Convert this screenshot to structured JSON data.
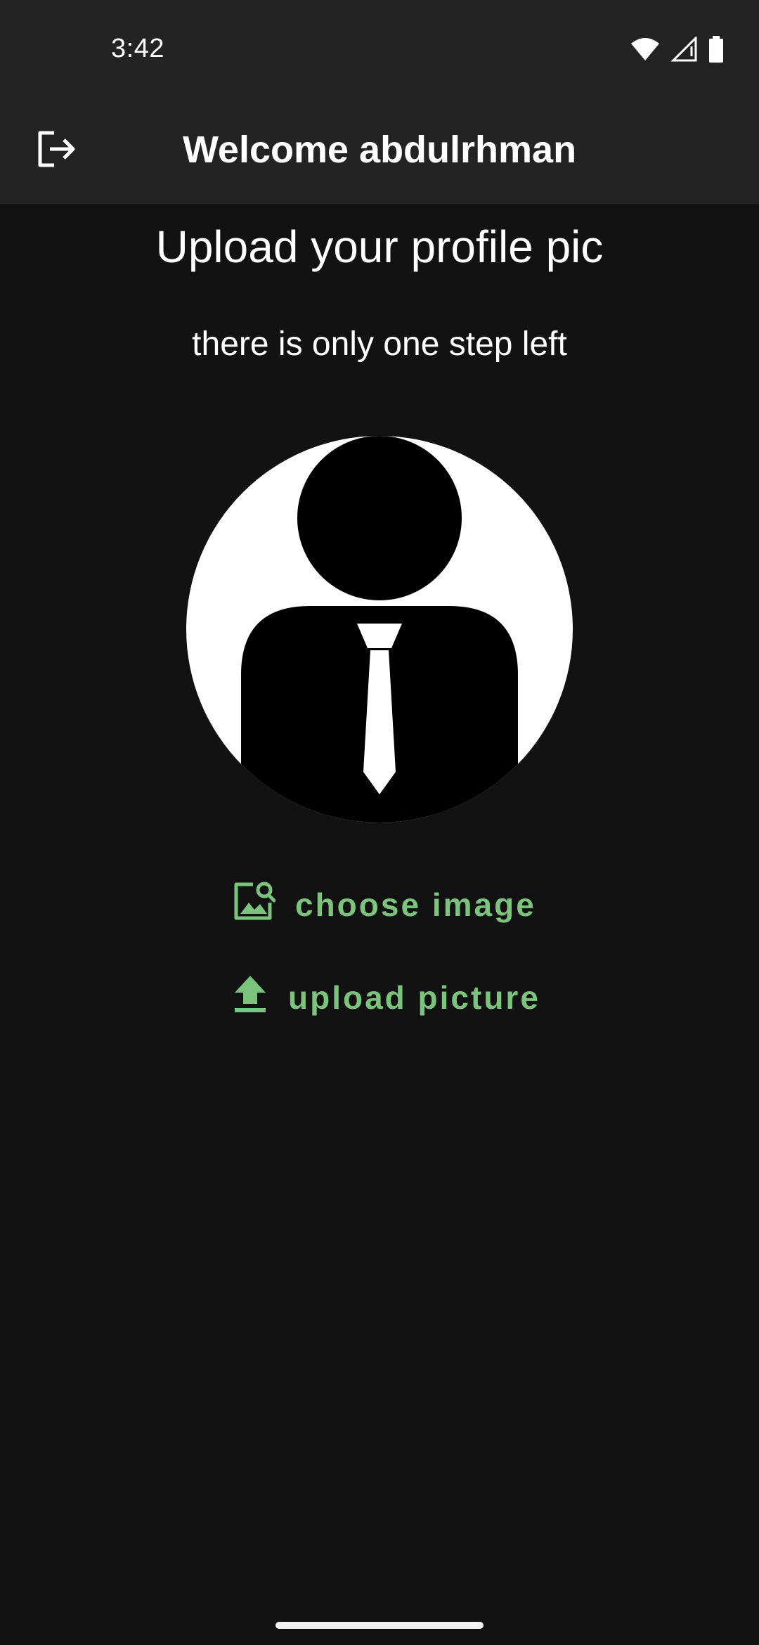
{
  "status_bar": {
    "time": "3:42",
    "icons": [
      "wifi-icon",
      "signal-icon",
      "battery-icon"
    ]
  },
  "app_bar": {
    "title": "Welcome abdulrhman",
    "leading_icon": "logout-icon"
  },
  "content": {
    "headline": "Upload your profile pic",
    "subline": "there is only one step left",
    "avatar_icon": "default-avatar-icon"
  },
  "actions": {
    "choose_image_label": "choose image",
    "choose_image_icon": "image-search-icon",
    "upload_picture_label": "upload picture",
    "upload_picture_icon": "upload-icon"
  },
  "colors": {
    "background": "#121212",
    "app_bar": "#232323",
    "accent": "#7cc37e",
    "text": "#ffffff"
  }
}
